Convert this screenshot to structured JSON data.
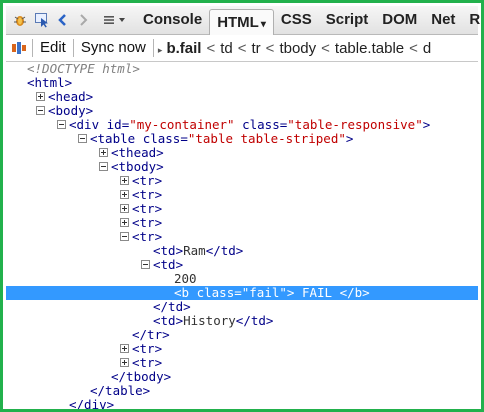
{
  "toolbar": {
    "icons": [
      "firebug-bug-icon",
      "inspect-pointer-icon",
      "back-icon",
      "forward-icon",
      "menu-icon",
      "dropdown-arrow-icon"
    ],
    "tabs": [
      {
        "label": "Console"
      },
      {
        "label": "HTML",
        "active": true,
        "arrow": "▾"
      },
      {
        "label": "CSS"
      },
      {
        "label": "Script"
      },
      {
        "label": "DOM"
      },
      {
        "label": "Net"
      },
      {
        "label": "R"
      }
    ]
  },
  "subtoolbar": {
    "edit_label": "Edit",
    "sync_label": "Sync now",
    "breadcrumbs": [
      "b.fail",
      "td",
      "tr",
      "tbody",
      "table.table",
      "d"
    ],
    "crumb_separator": "<"
  },
  "tree": {
    "doctype": "<!DOCTYPE html>",
    "html_open": "<html>",
    "head": "<head>",
    "body_open": "<body>",
    "div_open_tag": "<div",
    "div_id_attr": "id=",
    "div_id_val": "\"my-container\"",
    "div_class_attr": "class=",
    "div_class_val": "\"table-responsive\"",
    "div_close_bracket": ">",
    "table_open_tag": "<table",
    "table_class_attr": "class=",
    "table_class_val": "\"table table-striped\"",
    "table_close_bracket": ">",
    "thead": "<thead>",
    "tbody_open": "<tbody>",
    "tr": "<tr>",
    "td_ram_open": "<td>",
    "td_ram_text": "Ram",
    "td_ram_close": "</td>",
    "td_open": "<td>",
    "text_200": "200",
    "b_open_tag": "<b",
    "b_class_attr": "class=",
    "b_class_val": "\"fail\"",
    "b_close_bracket": ">",
    "b_text": "FAIL",
    "b_close": "</b>",
    "td_close": "</td>",
    "td_hist_open": "<td>",
    "td_hist_text": "History",
    "td_hist_close": "</td>",
    "tr_close": "</tr>",
    "tbody_close": "</tbody>",
    "table_close": "</table>",
    "div_close": "</div>"
  },
  "colors": {
    "frame_border": "#22b14c",
    "selection": "#3399ff",
    "tag": "#000088",
    "attr_value": "#c00000"
  }
}
